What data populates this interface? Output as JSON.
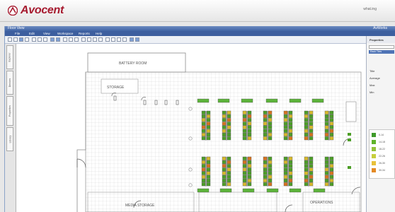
{
  "header": {
    "brand": "Avocent",
    "user": "what.ing",
    "colors": {
      "brand": "#a6192e"
    }
  },
  "window": {
    "title": "Floor View",
    "title_right": "AvWorks",
    "menu": [
      "File",
      "Edit",
      "View",
      "Workspace",
      "Reports",
      "Help"
    ]
  },
  "toolbar": {
    "icons": [
      "new-icon",
      "open-icon",
      "save-icon",
      "print-icon",
      "cut-icon",
      "copy-icon",
      "paste-icon",
      "undo-icon",
      "redo-icon",
      "zoom-in-icon",
      "zoom-out-icon",
      "zoom-fit-icon",
      "select-icon",
      "pan-icon",
      "line-icon",
      "rectangle-icon",
      "rotate-icon",
      "grid-icon",
      "snap-icon",
      "layer-icon",
      "settings-icon",
      "help-icon"
    ]
  },
  "left_tabs": [
    "Explorer",
    "Devices",
    "Properties",
    "Library"
  ],
  "floor_plan": {
    "rooms": {
      "battery": "BATTERY ROOM",
      "storage": "STORAGE",
      "media": "MEDIA STORAGE",
      "operations": "OPERATIONS"
    },
    "tile_colors": {
      "green": "#4c9e26",
      "yellow": "#d8b92a",
      "orange": "#d7731e",
      "rack": "#8a8a8a",
      "grid": "#c9c9c9"
    }
  },
  "right_panel": {
    "title": "Properties",
    "selector": "Rack Tiles",
    "labels": [
      "Title",
      "Average",
      "Max",
      "Min"
    ],
    "legend": [
      {
        "label": "0-14",
        "color": "#3f9a2a"
      },
      {
        "label": "14-18",
        "color": "#5fb32a"
      },
      {
        "label": "18-22",
        "color": "#93c23a"
      },
      {
        "label": "22-26",
        "color": "#c7cf3c"
      },
      {
        "label": "26-30",
        "color": "#e8c13a"
      },
      {
        "label": "30-34",
        "color": "#e48a24"
      }
    ]
  }
}
